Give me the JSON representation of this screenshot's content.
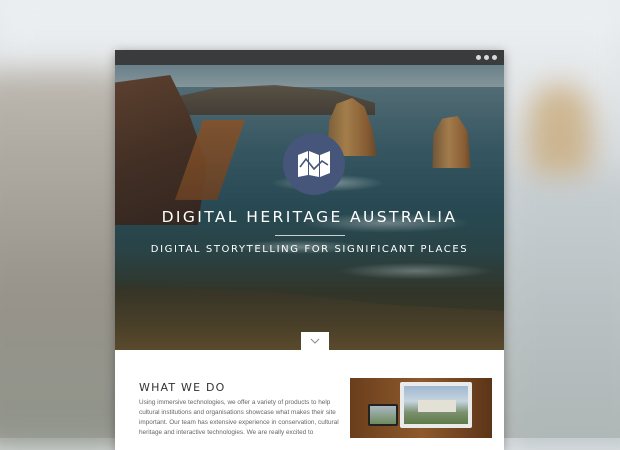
{
  "window": {
    "menu_icon": "more-dots-icon"
  },
  "hero": {
    "logo_icon": "folded-map-icon",
    "title": "DIGITAL HERITAGE AUSTRALIA",
    "subtitle": "DIGITAL STORYTELLING FOR SIGNIFICANT PLACES",
    "scroll_icon": "chevron-down-icon"
  },
  "what_we_do": {
    "heading": "WHAT WE DO",
    "body": "Using immersive technologies, we offer a variety of products to help cultural institutions and organisations showcase what makes their site important. Our team has extensive experience in conservation, cultural heritage and interactive technologies. We are really excited to"
  },
  "colors": {
    "chrome": "#3a3b3d",
    "logo_circle": "#46557a",
    "text_heading": "#333333",
    "text_body": "#666666"
  }
}
